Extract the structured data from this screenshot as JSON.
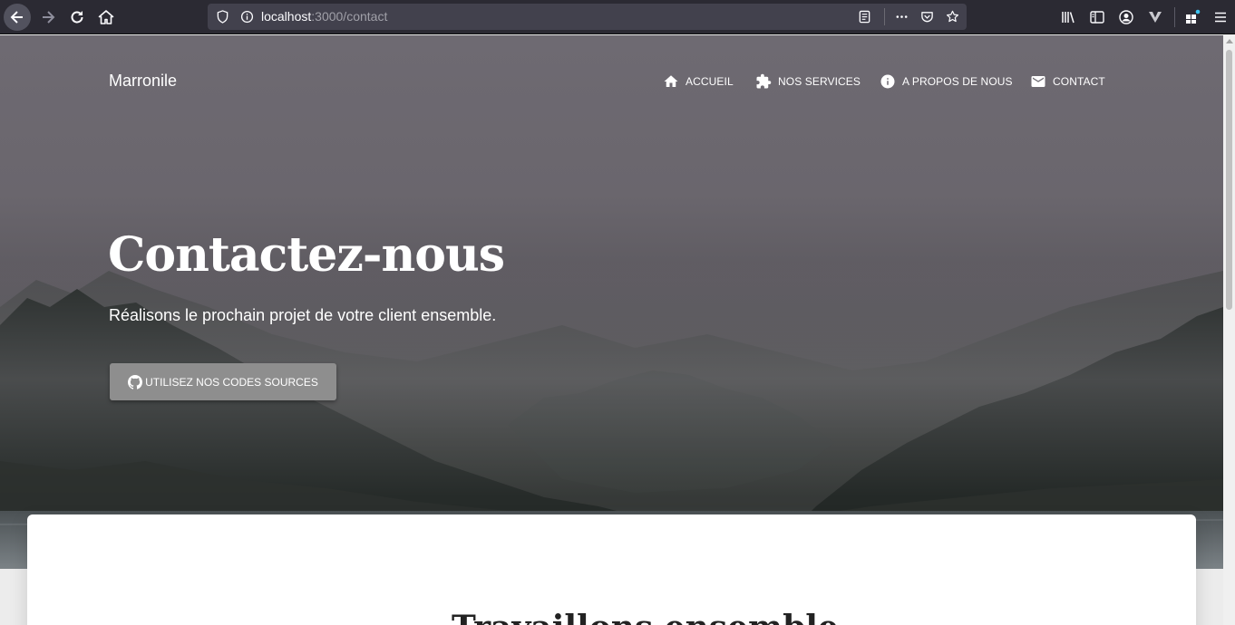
{
  "browser": {
    "url_host": "localhost",
    "url_path": ":3000/contact",
    "icons": [
      "back-icon",
      "forward-icon",
      "reload-icon",
      "home-icon",
      "shield-icon",
      "info-icon",
      "reader-view-icon",
      "more-icon",
      "pocket-icon",
      "bookmark-star-icon",
      "library-icon",
      "sidebar-icon",
      "account-icon",
      "vivaldi-icon",
      "extensions-icon",
      "menu-icon"
    ]
  },
  "navbar": {
    "brand": "Marronile",
    "items": [
      {
        "label": "ACCUEIL",
        "icon": "home-icon"
      },
      {
        "label": "NOS SERVICES",
        "icon": "puzzle-icon"
      },
      {
        "label": "A PROPOS DE NOUS",
        "icon": "info-icon"
      },
      {
        "label": "CONTACT",
        "icon": "mail-icon"
      }
    ]
  },
  "hero": {
    "title": "Contactez-nous",
    "subtitle": "Réalisons le prochain projet de votre client ensemble.",
    "button_label": "UTILISEZ NOS CODES SOURCES",
    "button_icon": "github-icon"
  },
  "card": {
    "heading": "Travaillons ensemble"
  },
  "colors": {
    "chrome_bg": "#2b2a33",
    "urlbar_bg": "#42414d",
    "button_bg": "#8e8e8e",
    "card_bg": "#ffffff"
  }
}
